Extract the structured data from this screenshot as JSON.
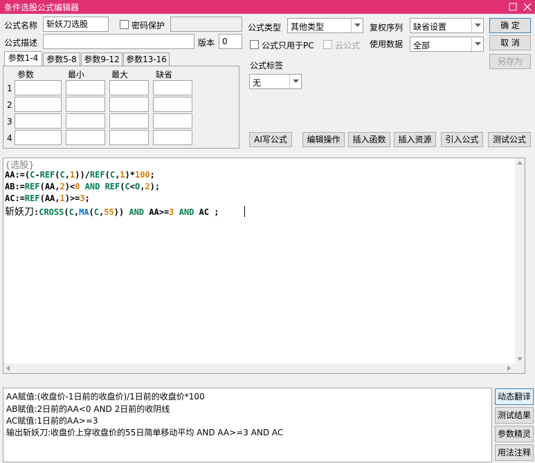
{
  "window": {
    "title": "条件选股公式编辑器"
  },
  "form": {
    "name_label": "公式名称",
    "name_value": "斩妖刀选股",
    "password_label": "密码保护",
    "desc_label": "公式描述",
    "desc_value": "",
    "version_label": "版本",
    "version_value": "0",
    "type_label": "公式类型",
    "type_value": "其他类型",
    "fq_label": "复权序列",
    "fq_value": "缺省设置",
    "pc_only_label": "公式只用于PC",
    "cloud_label": "云公式",
    "use_data_label": "使用数据",
    "use_data_value": "全部",
    "tag_label": "公式标签",
    "tag_value": "无"
  },
  "buttons": {
    "ok": "确  定",
    "cancel": "取  消",
    "save_as": "另存为",
    "ai": "AI写公式",
    "edit": "编辑操作",
    "insert_fn": "插入函数",
    "insert_res": "插入资源",
    "import": "引入公式",
    "test": "测试公式",
    "dyn_translate": "动态翻译",
    "test_result": "测试结果",
    "param_tune": "参数精灵",
    "usage_note": "用法注释"
  },
  "param_tabs": [
    "参数1-4",
    "参数5-8",
    "参数9-12",
    "参数13-16"
  ],
  "param_headers": {
    "name": "参数",
    "min": "最小",
    "max": "最大",
    "default": "缺省"
  },
  "param_rows": [
    "1",
    "2",
    "3",
    "4"
  ],
  "code": {
    "comment": "{选股}",
    "line1": {
      "a": "AA:=(",
      "b": "C",
      "c": "-",
      "d": "REF",
      "e": "(",
      "f": "C",
      "g": ",",
      "h": "1",
      "i": "))/",
      "j": "REF",
      "k": "(",
      "l": "C",
      "m": ",",
      "n": "1",
      "o": ")*",
      "p": "100",
      "q": ";"
    },
    "line2": {
      "a": "AB:=",
      "b": "REF",
      "c": "(AA,",
      "d": "2",
      "e": ")<",
      "f": "0",
      "g": " ",
      "h": "AND",
      "i": " ",
      "j": "REF",
      "k": "(",
      "l": "C",
      "m": "<",
      "n": "O",
      "o": ",",
      "p": "2",
      "q": ");"
    },
    "line3": {
      "a": "AC:=",
      "b": "REF",
      "c": "(AA,",
      "d": "1",
      "e": ")>=",
      "f": "3",
      "g": ";"
    },
    "line4": {
      "a": "斩妖刀",
      "b": ":",
      "c": "CROSS",
      "d": "(",
      "e": "C",
      "f": ",",
      "g": "MA",
      "h": "(",
      "i": "C",
      "j": ",",
      "k": "55",
      "l": ")) ",
      "m": "AND",
      "n": " AA>=",
      "o": "3",
      "p": " ",
      "q": "AND",
      "r": " AC ;"
    }
  },
  "explain": [
    "AA赋值:(收盘价-1日前的收盘价)/1日前的收盘价*100",
    "AB赋值:2日前的AA<0 AND 2日前的收阴线",
    "AC赋值:1日前的AA>=3",
    "输出斩妖刀:收盘价上穿收盘价的55日简单移动平均 AND AA>=3 AND AC"
  ],
  "colors": {
    "titlebar": "#e03070",
    "function": "#007b4a",
    "number": "#d47a00",
    "ma": "#0b73c8",
    "comment": "#7f7f7f"
  }
}
